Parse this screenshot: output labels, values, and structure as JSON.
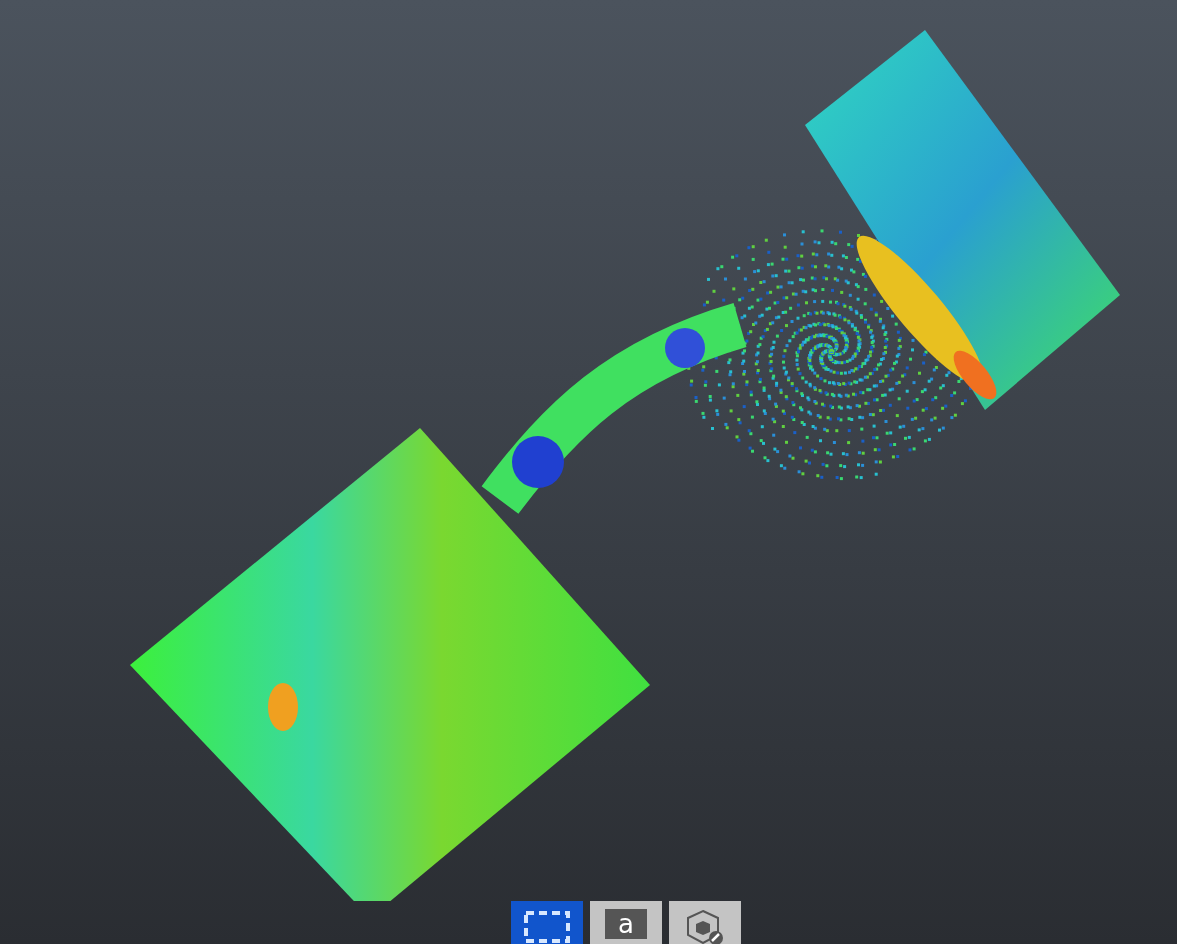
{
  "toolbar": {
    "buttons": [
      {
        "kind": "select-box",
        "selected": true
      },
      {
        "kind": "annotation",
        "label": "a",
        "selected": false
      },
      {
        "kind": "edit-volume",
        "selected": false
      }
    ]
  }
}
